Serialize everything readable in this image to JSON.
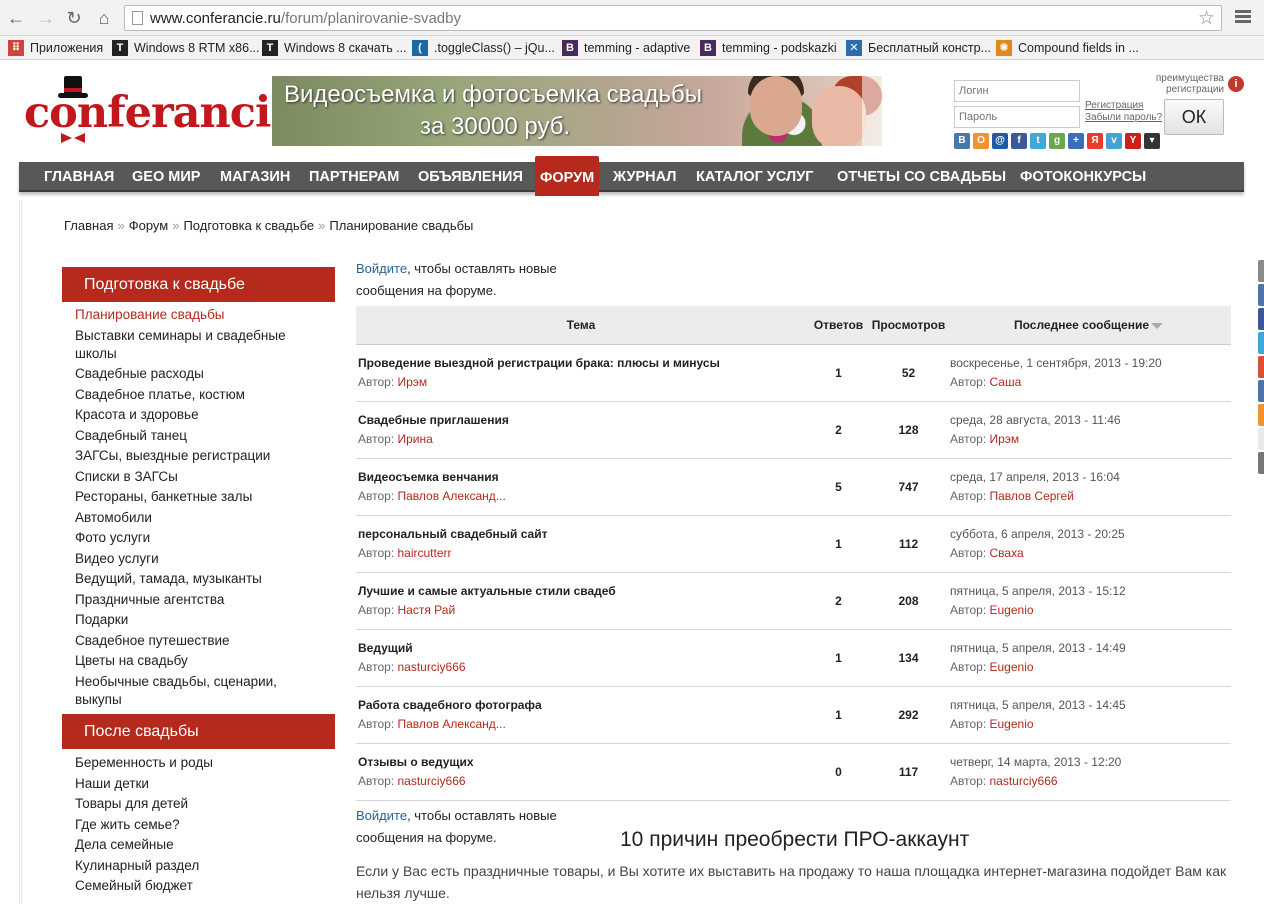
{
  "browser": {
    "url_host": "www.conferancie.ru",
    "url_path": "/forum/planirovanie-svadby",
    "bookmarks": [
      {
        "label": "Приложения",
        "icon": "apps-grid-icon",
        "color": "#d0443c"
      },
      {
        "label": "Windows 8 RTM x86...",
        "icon": "t-icon",
        "color": "#222222"
      },
      {
        "label": "Windows 8 скачать ...",
        "icon": "t-icon",
        "color": "#222222"
      },
      {
        "label": ".toggleClass() – jQu...",
        "icon": "jquery-icon",
        "color": "#1a6aa8"
      },
      {
        "label": "temming - adaptive",
        "icon": "b-icon",
        "color": "#4a2a5a"
      },
      {
        "label": "temming - podskazki",
        "icon": "b-icon",
        "color": "#4a2a5a"
      },
      {
        "label": "Бесплатный констр...",
        "icon": "x-icon",
        "color": "#2b6cb0"
      },
      {
        "label": "Compound fields in ...",
        "icon": "gear-icon",
        "color": "#e08a1e"
      }
    ]
  },
  "header": {
    "logo_text": "conferancie",
    "banner_line1": "Видеосъемка и фотосъемка свадьбы",
    "banner_line2": "за 30000 руб.",
    "login_placeholder": "Логин",
    "password_placeholder": "Пароль",
    "register_label": "Регистрация",
    "forgot_label": "Забыли пароль?",
    "ok_label": "ОК",
    "advantages_line1": "преимущества",
    "advantages_line2": "регистрации",
    "info_label": "i",
    "social": [
      {
        "label": "В",
        "color": "#4a76a8"
      },
      {
        "label": "О",
        "color": "#f2932c"
      },
      {
        "label": "@",
        "color": "#1e5ba6"
      },
      {
        "label": "f",
        "color": "#3b5998"
      },
      {
        "label": "t",
        "color": "#3fa7d8"
      },
      {
        "label": "g",
        "color": "#6aa84f"
      },
      {
        "label": "+",
        "color": "#3b6dbb"
      },
      {
        "label": "Я",
        "color": "#e93c2f"
      },
      {
        "label": "v",
        "color": "#44a3d6"
      },
      {
        "label": "Y",
        "color": "#cc2020"
      },
      {
        "label": "▾",
        "color": "#333333"
      }
    ]
  },
  "menu": [
    {
      "label": "ГЛАВНАЯ",
      "active": false
    },
    {
      "label": "GEO МИР",
      "active": false
    },
    {
      "label": "МАГАЗИН",
      "active": false
    },
    {
      "label": "ПАРТНЕРАМ",
      "active": false
    },
    {
      "label": "ОБЪЯВЛЕНИЯ",
      "active": false
    },
    {
      "label": "ФОРУМ",
      "active": true
    },
    {
      "label": "ЖУРНАЛ",
      "active": false
    },
    {
      "label": "КАТАЛОГ УСЛУГ",
      "active": false
    },
    {
      "label": "ОТЧЕТЫ СО СВАДЬБЫ",
      "active": false
    },
    {
      "label": "ФОТОКОНКУРСЫ",
      "active": false
    }
  ],
  "breadcrumb": [
    "Главная",
    "Форум",
    "Подготовка к свадьбе",
    "Планирование свадьбы"
  ],
  "breadcrumb_sep": "»",
  "sidebar": {
    "section1_title": "Подготовка к свадьбе",
    "section1_items": [
      "Планирование свадьбы",
      "Выставки семинары и свадебные школы",
      "Свадебные расходы",
      "Свадебное платье, костюм",
      "Красота и здоровье",
      "Свадебный танец",
      "ЗАГСы, выездные регистрации",
      "Списки в ЗАГСы",
      "Рестораны, банкетные залы",
      "Автомобили",
      "Фото услуги",
      "Видео услуги",
      "Ведущий, тамада, музыканты",
      "Праздничные агентства",
      "Подарки",
      "Свадебное путешествие",
      "Цветы на свадьбу",
      "Необычные свадьбы, сценарии, выкупы"
    ],
    "section2_title": "После свадьбы",
    "section2_items": [
      "Беременность и роды",
      "Наши детки",
      "Товары для детей",
      "Где жить семье?",
      "Дела семейные",
      "Кулинарный раздел",
      "Семейный бюджет"
    ]
  },
  "forum": {
    "login_link": "Войдите",
    "login_rest": ", чтобы оставлять новые сообщения на форуме.",
    "col_topic": "Тема",
    "col_replies": "Ответов",
    "col_views": "Просмотров",
    "col_last": "Последнее сообщение",
    "author_prefix": "Автор: ",
    "topics": [
      {
        "title": "Проведение выездной регистрации брака: плюсы и минусы",
        "author": "Ирэм",
        "replies": "1",
        "views": "52",
        "last_date": "воскресенье, 1 сентября, 2013 - 19:20",
        "last_author": "Саша"
      },
      {
        "title": "Свадебные приглашения",
        "author": "Ирина",
        "replies": "2",
        "views": "128",
        "last_date": "среда, 28 августа, 2013 - 11:46",
        "last_author": "Ирэм"
      },
      {
        "title": "Видеосъемка венчания",
        "author": "Павлов Александ...",
        "replies": "5",
        "views": "747",
        "last_date": "среда, 17 апреля, 2013 - 16:04",
        "last_author": "Павлов Сергей"
      },
      {
        "title": "персональный свадебный сайт",
        "author": "haircutterr",
        "replies": "1",
        "views": "112",
        "last_date": "суббота, 6 апреля, 2013 - 20:25",
        "last_author": "Сваха"
      },
      {
        "title": "Лучшие и самые актуальные стили свадеб",
        "author": "Настя Рай",
        "replies": "2",
        "views": "208",
        "last_date": "пятница, 5 апреля, 2013 - 15:12",
        "last_author": "Eugenio"
      },
      {
        "title": "Ведущий",
        "author": "nasturciy666",
        "replies": "1",
        "views": "134",
        "last_date": "пятница, 5 апреля, 2013 - 14:49",
        "last_author": "Eugenio"
      },
      {
        "title": "Работа свадебного фотографа",
        "author": "Павлов Александ...",
        "replies": "1",
        "views": "292",
        "last_date": "пятница, 5 апреля, 2013 - 14:45",
        "last_author": "Eugenio"
      },
      {
        "title": "Отзывы о ведущих",
        "author": "nasturciy666",
        "replies": "0",
        "views": "117",
        "last_date": "четверг, 14 марта, 2013 - 12:20",
        "last_author": "nasturciy666"
      }
    ],
    "pro_title": "10 причин преобрести ПРО-аккаунт",
    "pro_text": "Если у Вас есть праздничные товары, и Вы хотите их выставить на продажу то наша площадка интернет-магазина подойдет Вам как нельзя лучше."
  },
  "colors": {
    "brand_red": "#b52a1c",
    "menu_gray": "#585858",
    "link_blue": "#2a6496"
  }
}
